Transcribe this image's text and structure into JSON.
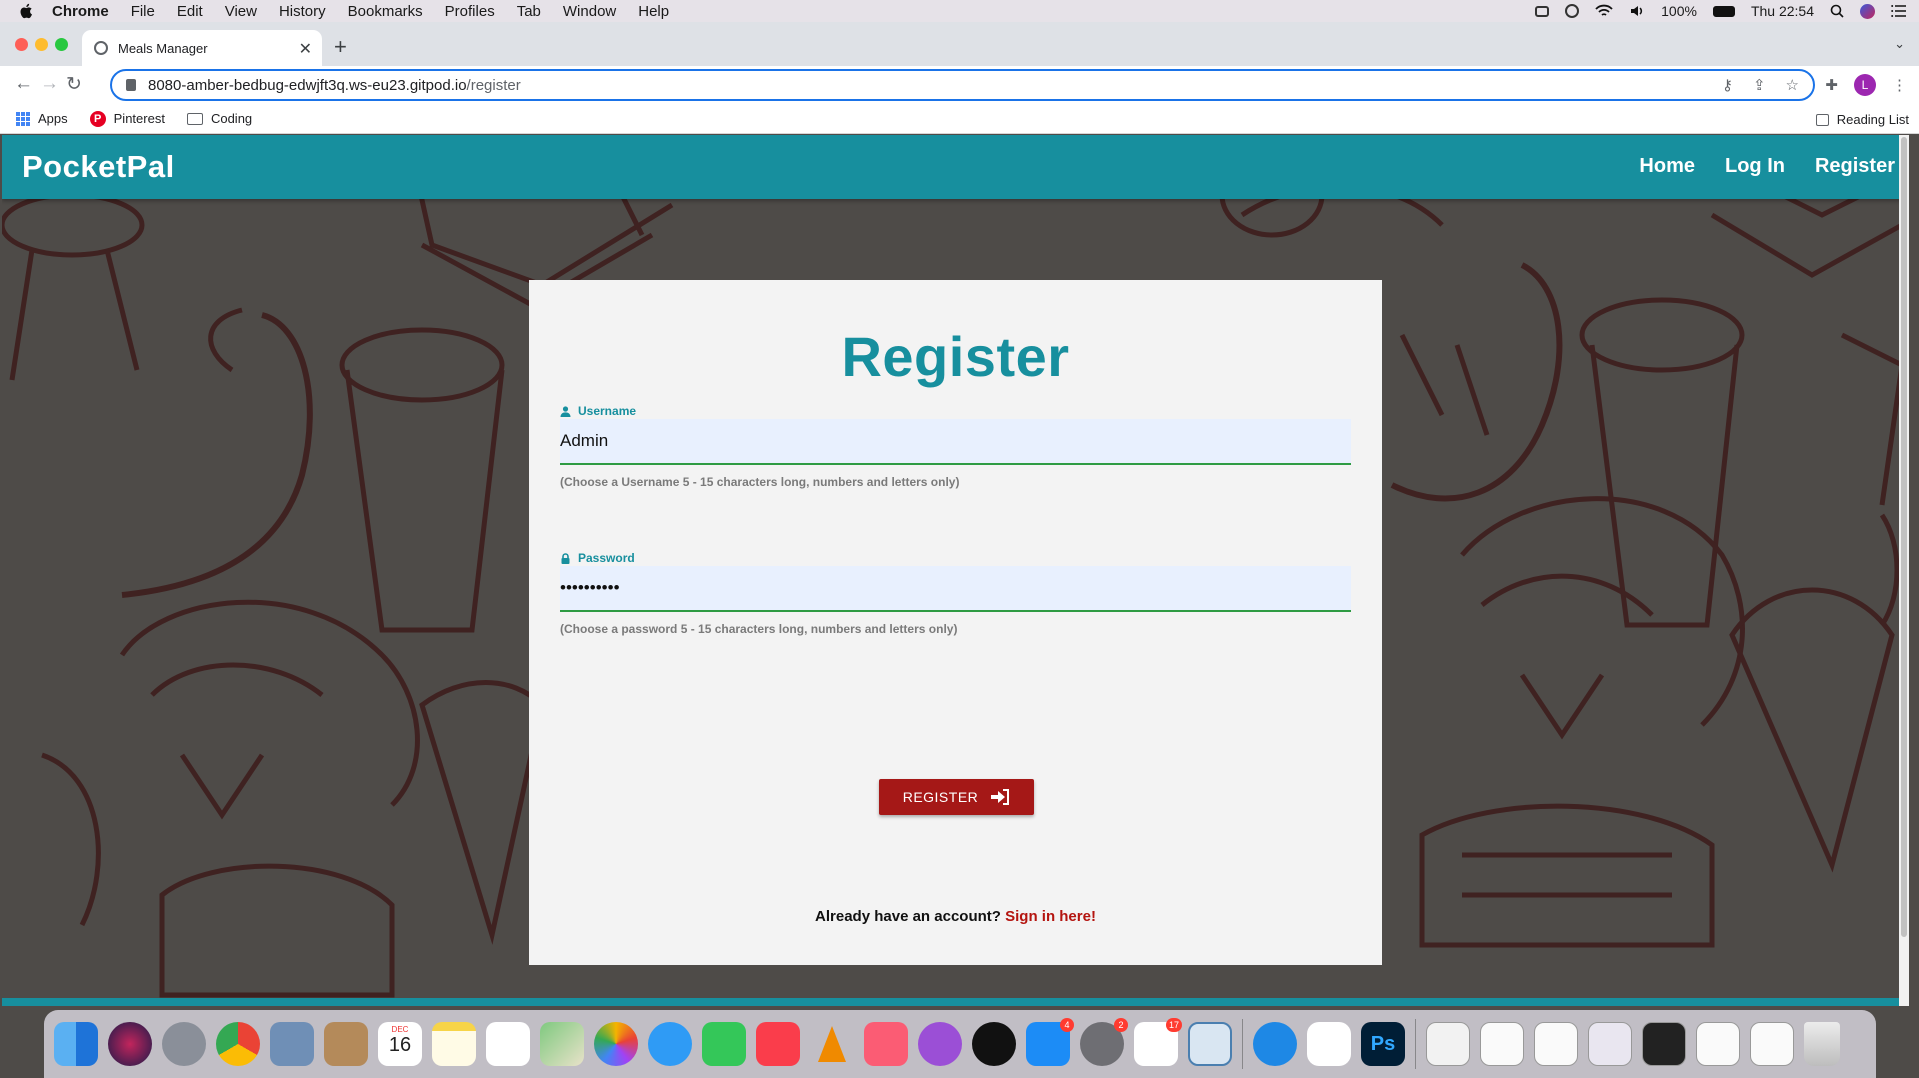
{
  "menubar": {
    "app_name": "Chrome",
    "items": [
      "File",
      "Edit",
      "View",
      "History",
      "Bookmarks",
      "Profiles",
      "Tab",
      "Window",
      "Help"
    ],
    "battery": "100%",
    "clock": "Thu 22:54"
  },
  "browser": {
    "tab_title": "Meals Manager",
    "url_host": "8080-amber-bedbug-edwjft3q.ws-eu23.gitpod.io",
    "url_path": "/register",
    "profile_initial": "L",
    "bookmarks": [
      "Apps",
      "Pinterest",
      "Coding"
    ],
    "reading_list": "Reading List"
  },
  "site": {
    "brand": "PocketPal",
    "nav": [
      "Home",
      "Log In",
      "Register"
    ]
  },
  "form": {
    "title": "Register",
    "username_label": "Username",
    "username_value": "Admin",
    "username_help": "(Choose a Username 5 - 15 characters long, numbers and letters only)",
    "password_label": "Password",
    "password_value": "••••••••••",
    "password_help": "(Choose a password 5 - 15 characters long, numbers and letters only)",
    "submit_label": "REGISTER",
    "signin_prompt": "Already have an account?",
    "signin_link": "Sign in here!"
  },
  "dock": {
    "badges": {
      "app_store": "4",
      "system_prefs": "2",
      "slack": "17"
    },
    "calendar_day": "16",
    "calendar_month": "DEC"
  },
  "colors": {
    "brand_teal": "#178f9e",
    "button_red": "#a51817",
    "link_red": "#b4140f",
    "input_bg": "#e8f0fe",
    "input_border": "#2e9b43"
  }
}
